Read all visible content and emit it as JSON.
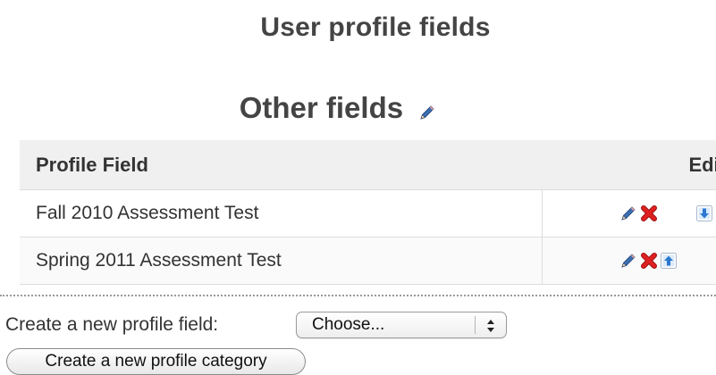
{
  "page_title": "User profile fields",
  "category": {
    "name": "Other fields",
    "edit_icon": "pencil-icon"
  },
  "table": {
    "headers": {
      "profile_field": "Profile Field",
      "edit": "Edit"
    },
    "rows": [
      {
        "name": "Fall 2010 Assessment Test",
        "actions": [
          "pencil-icon",
          "delete-x-icon",
          "move-down-icon"
        ]
      },
      {
        "name": "Spring 2011 Assessment Test",
        "actions": [
          "pencil-icon",
          "delete-x-icon",
          "move-up-icon"
        ]
      }
    ]
  },
  "create_field": {
    "label": "Create a new profile field:",
    "selected_option": "Choose..."
  },
  "create_category_button": "Create a new profile category",
  "colors": {
    "delete": "#d41e1e",
    "move_arrow": "#2b78d0",
    "pencil_body": "#3b6fb3",
    "header_bg": "#f0f0f0",
    "heading_text": "#444444"
  }
}
